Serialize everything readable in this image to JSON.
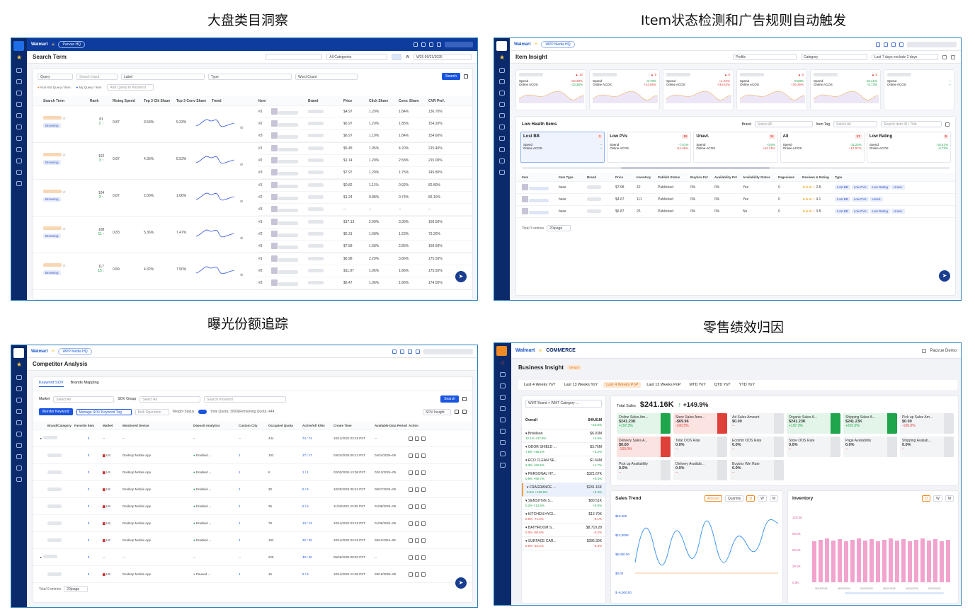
{
  "titles": {
    "tl": "大盘类目洞察",
    "tr": "Item状态检测和广告规则自动触发",
    "bl": "曝光份额追踪",
    "br": "零售绩效归因"
  },
  "colors": {
    "brand": "#0b2a6b",
    "accent": "#1a55e0",
    "up": "#1aa34a",
    "down": "#e0403a"
  },
  "p1": {
    "brand": "Walmart",
    "tenant": "Pacvue HQ",
    "page": "Search Term",
    "category": "All Categories",
    "w_label": "W",
    "date": "W25 06/21/2026",
    "filters": {
      "query": "Query",
      "search": "Search Input",
      "label": "Label",
      "label_val": "Select All",
      "type": "Type",
      "type_val": "Select All",
      "wc": "Word Count",
      "wc_val": "Select All",
      "search_btn": "Search"
    },
    "legend": {
      "a": "Non-Std Query / Item",
      "b": "My Query / Item",
      "add": "Add Query to Keyword"
    },
    "cols": [
      "Search Term",
      "Rank",
      "Rising Speed",
      "Top 3 Clk Share",
      "Top 3 Conv Share",
      "Trend",
      "Item",
      "Brand",
      "Price",
      "Click Share",
      "Conv. Share",
      "CVR Perf."
    ],
    "terms": [
      {
        "rank": "81",
        "chg": "2",
        "speed": "0.87",
        "clk": "3.59%",
        "conv": "5.33%",
        "badge": "Browsing"
      },
      {
        "rank": "102",
        "chg": "3",
        "speed": "0.87",
        "clk": "4.35%",
        "conv": "8.53%",
        "badge": "Browsing"
      },
      {
        "rank": "104",
        "chg": "3",
        "speed": "0.87",
        "clk": "2.00%",
        "conv": "1.66%",
        "badge": "Browsing"
      },
      {
        "rank": "108",
        "chg": "11",
        "speed": "0.83",
        "clk": "5.36%",
        "conv": "7.47%",
        "badge": "Browsing"
      },
      {
        "rank": "117",
        "chg": "15",
        "speed": "0.89",
        "clk": "4.32%",
        "conv": "7.50%",
        "badge": "Browsing"
      }
    ],
    "items": [
      [
        "#1",
        "$4.97",
        "1.20%",
        "1.84%",
        "136.70%"
      ],
      [
        "#2",
        "$6.97",
        "1.20%",
        "1.85%",
        "154.20%"
      ],
      [
        "#3",
        "$6.97",
        "1.19%",
        "1.84%",
        "154.60%"
      ],
      [
        "#1",
        "$5.45",
        "1.95%",
        "4.20%",
        "215.40%"
      ],
      [
        "#2",
        "$1.14",
        "1.20%",
        "2.58%",
        "215.00%"
      ],
      [
        "#3",
        "$7.97",
        "1.20%",
        "1.75%",
        "145.80%"
      ],
      [
        "#1",
        "$0.82",
        "1.11%",
        "0.92%",
        "82.80%"
      ],
      [
        "#2",
        "$1.24",
        "0.88%",
        "0.74%",
        "83.10%"
      ],
      [
        "#3",
        "--",
        "--",
        "--",
        "--"
      ],
      [
        "#1",
        "$17.13",
        "2.00%",
        "3.39%",
        "169.50%"
      ],
      [
        "#2",
        "$6.31",
        "1.68%",
        "1.23%",
        "73.20%"
      ],
      [
        "#3",
        "$7.58",
        "1.68%",
        "2.85%",
        "169.60%"
      ],
      [
        "#1",
        "$6.98",
        "2.20%",
        "3.86%",
        "175.50%"
      ],
      [
        "#2",
        "$11.97",
        "1.06%",
        "1.86%",
        "175.50%"
      ],
      [
        "#3",
        "$6.47",
        "1.06%",
        "1.86%",
        "174.50%"
      ]
    ]
  },
  "p2": {
    "brand": "Walmart",
    "tenant": "WPP Media HQ",
    "page": "Item Insight",
    "profile": "Profile",
    "category": "Category",
    "cat_val": "Select All",
    "range": "Last 7 days exclude 2 days",
    "metrics": [
      {
        "badge": "10",
        "spend": "Spend",
        "sv": "+10.28%",
        "acos": "Online ACOS",
        "av": "-13.36%"
      },
      {
        "badge": "9",
        "spend": "Spend",
        "sv": "-8.73%",
        "acos": "Online ACOS",
        "av": "+14.86%"
      },
      {
        "badge": "8",
        "spend": "Spend",
        "sv": "+1.04%",
        "acos": "Online ACOS",
        "av": "+30.52%"
      },
      {
        "badge": "8",
        "spend": "Spend",
        "sv": "-9.03%",
        "acos": "Online ACOS",
        "av": "+26.36%"
      },
      {
        "badge": "6",
        "spend": "Spend",
        "sv": "-10.41%",
        "acos": "Online ACOS",
        "av": "-5.73%"
      },
      {
        "badge": "",
        "spend": "Spend",
        "sv": "--",
        "acos": "Online ACOS",
        "av": "--"
      }
    ],
    "low_title": "Low Health Items",
    "brand_f": "Brand",
    "brand_v": "Select All",
    "tag_f": "Item Tag",
    "tag_v": "Select All",
    "search_ph": "Search Item ID / Title",
    "tabs": [
      {
        "n": "Lost BB",
        "c": "3",
        "s": "Spend",
        "sv": "--",
        "a": "Online ACOS",
        "av": "--"
      },
      {
        "n": "Low PVs",
        "c": "10",
        "s": "Spend",
        "sv": "-7.51%",
        "a": "Online ACOS",
        "av": "+11.66%"
      },
      {
        "n": "Unavl.",
        "c": "11",
        "s": "Spend",
        "sv": "-0.5%",
        "a": "Online ACOS",
        "av": "+44.74%"
      },
      {
        "n": "All",
        "c": "37",
        "s": "Spend",
        "sv": "-11.23%",
        "a": "Online ACOS",
        "av": "+12.67%"
      },
      {
        "n": "Low Rating",
        "c": "8",
        "s": "Spend",
        "sv": "-15.41%",
        "a": "Online ACOS",
        "av": "-5.73%"
      }
    ],
    "cols": [
      "Item",
      "Item Type",
      "Brand",
      "Price",
      "Inventory",
      "Publish Status",
      "Buybox Pct",
      "Availability Pct",
      "Availability Status",
      "Pageviews",
      "Reviews & Rating",
      "Type"
    ],
    "rows": [
      {
        "type": "base",
        "price": "$7.98",
        "inv": "42",
        "pub": "Published",
        "bb": "0%",
        "av": "0%",
        "st": "Yes",
        "pv": "0",
        "r": "2.8",
        "tags": [
          "Lost BB",
          "Low PVs",
          "Low Rating",
          "Unavl."
        ]
      },
      {
        "type": "base",
        "price": "$4.67",
        "inv": "111",
        "pub": "Published",
        "bb": "0%",
        "av": "0%",
        "st": "Yes",
        "pv": "0",
        "r": "4.1",
        "tags": [
          "Lost BB",
          "Low PVs",
          "Unavl."
        ]
      },
      {
        "type": "base",
        "price": "$6.87",
        "inv": "25",
        "pub": "Published",
        "bb": "0%",
        "av": "0%",
        "st": "No",
        "pv": "0",
        "r": "3.8",
        "tags": [
          "Lost BB",
          "Low PVs",
          "Low Rating",
          "Unavl."
        ]
      }
    ],
    "footer": "Total 3 entries",
    "page_size": "20/page"
  },
  "p3": {
    "brand": "Walmart",
    "tenant": "WPP Media HQ",
    "page": "Competitor Analysis",
    "tabs": [
      "Keyword SOV",
      "Brands Mapping"
    ],
    "market": "Market",
    "market_v": "Select All",
    "sov": "SOV Group",
    "sov_v": "Select All",
    "search_ph": "Search Keyword",
    "search_btn": "Search",
    "monitor": "Monitor Keyword",
    "manage": "Manage SOV Keyword Tag",
    "bulk": "Bulk Operation",
    "weight": "Weight Status",
    "quota": "Total Quota: 3000|Remaining Quota: 444",
    "insight": "SOV Insight",
    "cols": [
      "Brand/Category",
      "Favorite Item",
      "Market",
      "Monitored Device",
      "Deposit Analytics",
      "Custom City",
      "Occupied Quota",
      "Active/All KWs",
      "Create Time",
      "Available Data Period",
      "Action"
    ],
    "rows": [
      {
        "fav": "0",
        "mk": "--",
        "dev": "--",
        "dep": "--",
        "city": "--",
        "q": "444",
        "kw": "74 / 74",
        "t": "10/14/2022 03:19 PST",
        "p": "--",
        "sub": false
      },
      {
        "fav": "0",
        "mk": "US",
        "dev": "Desktop  Mobile  App",
        "dep": "Enabled",
        "city": "1",
        "q": "102",
        "kw": "17 / 17",
        "t": "04/24/2026 05:13 PST",
        "p": "04/24/2026~05",
        "sub": true
      },
      {
        "fav": "0",
        "mk": "US",
        "dev": "Desktop  Mobile  App",
        "dep": "Enabled",
        "city": "1",
        "q": "6",
        "kw": "1 / 1",
        "t": "02/03/2026 13:08 PST",
        "p": "02/12/2024~05",
        "sub": true
      },
      {
        "fav": "0",
        "mk": "US",
        "dev": "Desktop  Mobile  App",
        "dep": "Enabled",
        "city": "1",
        "q": "30",
        "kw": "5 / 5",
        "t": "10/20/2024 05:43 PST",
        "p": "08/27/2024~05",
        "sub": true
      },
      {
        "fav": "0",
        "mk": "US",
        "dev": "Desktop  Mobile  App",
        "dep": "Enabled",
        "city": "1",
        "q": "36",
        "kw": "6 / 6",
        "t": "11/18/2022 23:55 PST",
        "p": "01/08/2024~05",
        "sub": true
      },
      {
        "fav": "0",
        "mk": "US",
        "dev": "Desktop  Mobile  App",
        "dep": "Enabled",
        "city": "1",
        "q": "78",
        "kw": "13 / 13",
        "t": "10/14/2022 03:19 PST",
        "p": "01/08/2024~05",
        "sub": true
      },
      {
        "fav": "0",
        "mk": "US",
        "dev": "Desktop  Mobile  App",
        "dep": "Enabled",
        "city": "1",
        "q": "192",
        "kw": "32 / 32",
        "t": "10/14/2022 03:19 PST",
        "p": "05/11/2024~05",
        "sub": true
      },
      {
        "fav": "0",
        "mk": "--",
        "dev": "--",
        "dep": "--",
        "city": "--",
        "q": "225",
        "kw": "40 / 40",
        "t": "05/26/2026 08:50 PST",
        "p": "--",
        "sub": false
      },
      {
        "fav": "0",
        "mk": "US",
        "dev": "Desktop  Mobile  App",
        "dep": "Paused",
        "city": "1",
        "q": "15",
        "kw": "5 / 5",
        "t": "10/14/2022 12:38 PST",
        "p": "09/19/2025~05",
        "sub": true
      }
    ],
    "footer": "Total 9 entries",
    "page_size": "20/page"
  },
  "p4": {
    "brand": "Walmart",
    "brand2": "COMMERCE",
    "user": "Pacvue Demo",
    "page": "Business Insight",
    "vendor": "Vendor",
    "periods": [
      "Last 4 Weeks YoY",
      "Last 13 Weeks YoY",
      "Last 4 Weeks PoP",
      "Last 13 Weeks PoP",
      "MTD YoY",
      "QTD YoY",
      "YTD YoY"
    ],
    "tree_hdr": "WMT Brand > WMT Category ...",
    "tree": [
      {
        "n": "Overall",
        "v": "$49.81M",
        "c": "+15.5%",
        "pct": "",
        "d": "up"
      },
      {
        "n": "Brisklean",
        "v": "$6.03M",
        "c": "+3.6%",
        "pct": "12.1%  +37.9%",
        "d": "up"
      },
      {
        "n": "ODOR SHIELD ...",
        "v": "$3.76M",
        "c": "+2.2%",
        "pct": "7.5%  +48.2%",
        "d": "up"
      },
      {
        "n": "ECO CLEAN SE...",
        "v": "$1.64M",
        "c": "+1.7%",
        "pct": "3.3%  +92.5%",
        "d": "up"
      },
      {
        "n": "PERSONAL HY...",
        "v": "$321.67K",
        "c": "+0.4%",
        "pct": "0.6%  +90.7%",
        "d": "up"
      },
      {
        "n": "FRAGRANCE ...",
        "v": "$241.16K",
        "c": "+0.3%",
        "pct": "0.5%  +149.9%",
        "d": "up"
      },
      {
        "n": "SENSITIVE S...",
        "v": "$80.51K",
        "c": "+0.0%",
        "pct": "0.2%  +13.6%",
        "d": "up"
      },
      {
        "n": "KITCHEN HYGI...",
        "v": "$13.70K",
        "c": "-0.1%",
        "pct": "0.0%  -71.4%",
        "d": "down"
      },
      {
        "n": "BATHROOM S...",
        "v": "$8,719.28",
        "c": "-0.2%",
        "pct": "0.0%  -90.5%",
        "d": "down"
      },
      {
        "n": "SURFACE CAR...",
        "v": "$286.30K",
        "c": "-0.3%",
        "pct": "0.6%  -32.4%",
        "d": "down"
      }
    ],
    "total_label": "Total Sales",
    "total": "$241.16K",
    "total_chg": "+149.9%",
    "cells": [
      {
        "n": "Online Sales Am...",
        "v": "$241.23K",
        "c": "+197.3%",
        "k": "g"
      },
      {
        "n": "Store Sales Amo...",
        "v": "-$69.96",
        "c": "-100.5%",
        "k": "r"
      },
      {
        "n": "Ad Sales Amount",
        "v": "$0.00",
        "c": "--",
        "k": "n"
      },
      {
        "n": "Organic Sales A...",
        "v": "$241.23K",
        "c": "+197.3%",
        "k": "g"
      },
      {
        "n": "Shipping Sales A...",
        "v": "$241.23K",
        "c": "+201.6%",
        "k": "g"
      },
      {
        "n": "Pick up Sales Am...",
        "v": "$0.00",
        "c": "-100.0%",
        "k": "n"
      },
      {
        "n": "Delivery Sales A...",
        "v": "$0.00",
        "c": "-100.0%",
        "k": "r"
      },
      {
        "n": "Total OOS Rate",
        "v": "0.0%",
        "c": "--",
        "k": "n"
      },
      {
        "n": "Ecomm OOS Rate",
        "v": "0.0%",
        "c": "--",
        "k": "n"
      },
      {
        "n": "Store OOS Rate",
        "v": "0.0%",
        "c": "--",
        "k": "n"
      },
      {
        "n": "Page Availability",
        "v": "0.0%",
        "c": "--",
        "k": "n"
      },
      {
        "n": "Shipping Availab...",
        "v": "0.0%",
        "c": "--",
        "k": "n"
      },
      {
        "n": "Pick up Availability",
        "v": "0.0%",
        "c": "--",
        "k": "n"
      },
      {
        "n": "Delivery Availabi...",
        "v": "0.0%",
        "c": "--",
        "k": "n"
      },
      {
        "n": "Buybox Win Rate",
        "v": "0.0%",
        "c": "--",
        "k": "n"
      }
    ],
    "trend_title": "Sales Trend",
    "trend_tabs": [
      "Amount",
      "Quantity"
    ],
    "gran": [
      "D",
      "W",
      "M"
    ],
    "trend_y": [
      "$18.00K",
      "$12,000K",
      "$6,000.00",
      "$0.00",
      "$ -6,000.00"
    ],
    "inv_title": "Inventory",
    "inv_y": [
      "120.0K",
      "90.0K",
      "60.0K",
      "30.0K",
      "0.0K"
    ],
    "inv_x": [
      "06/16/2026",
      "06/18/2026",
      "06/20/2026",
      "06/22/2026",
      "06/24/2026",
      "06/26/2026"
    ]
  }
}
